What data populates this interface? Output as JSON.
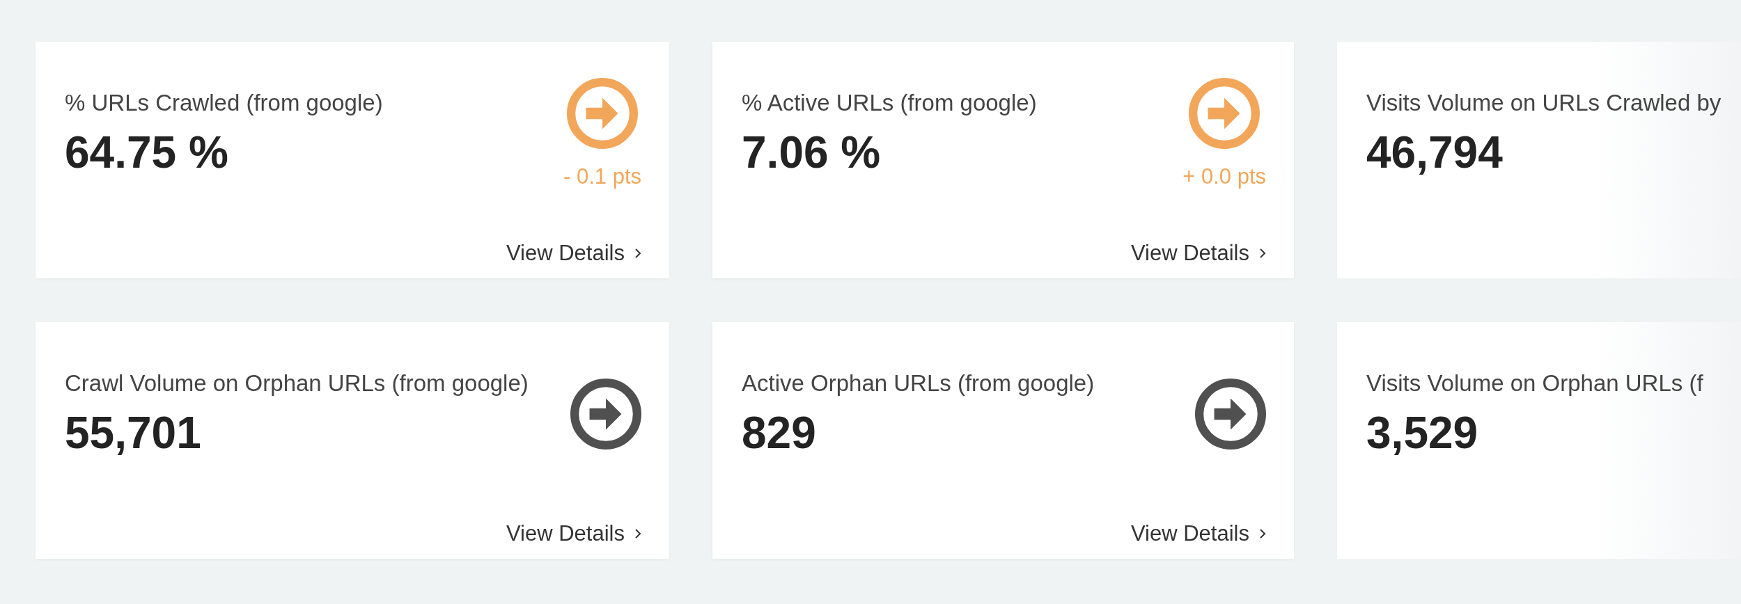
{
  "rows": [
    {
      "cards": [
        {
          "title": "% URLs Crawled (from google)",
          "value": "64.75 %",
          "faded": false,
          "indicator": {
            "color": "#f2a65a"
          },
          "change": "- 0.1 pts",
          "link": "View Details"
        },
        {
          "title": "% Active URLs (from google)",
          "value": "7.06 %",
          "faded": false,
          "indicator": {
            "color": "#f2a65a"
          },
          "change": "+ 0.0 pts",
          "link": "View Details"
        },
        {
          "title": "Visits Volume on URLs Crawled by",
          "value": "46,794",
          "faded": true
        }
      ]
    },
    {
      "cards": [
        {
          "title": "Crawl Volume on Orphan URLs (from google)",
          "value": "55,701",
          "faded": false,
          "indicator": {
            "color": "#505050"
          },
          "link": "View Details"
        },
        {
          "title": "Active Orphan URLs (from google)",
          "value": "829",
          "faded": false,
          "indicator": {
            "color": "#505050"
          },
          "link": "View Details"
        },
        {
          "title": "Visits Volume on Orphan URLs (f",
          "value": "3,529",
          "faded": true
        }
      ]
    }
  ]
}
